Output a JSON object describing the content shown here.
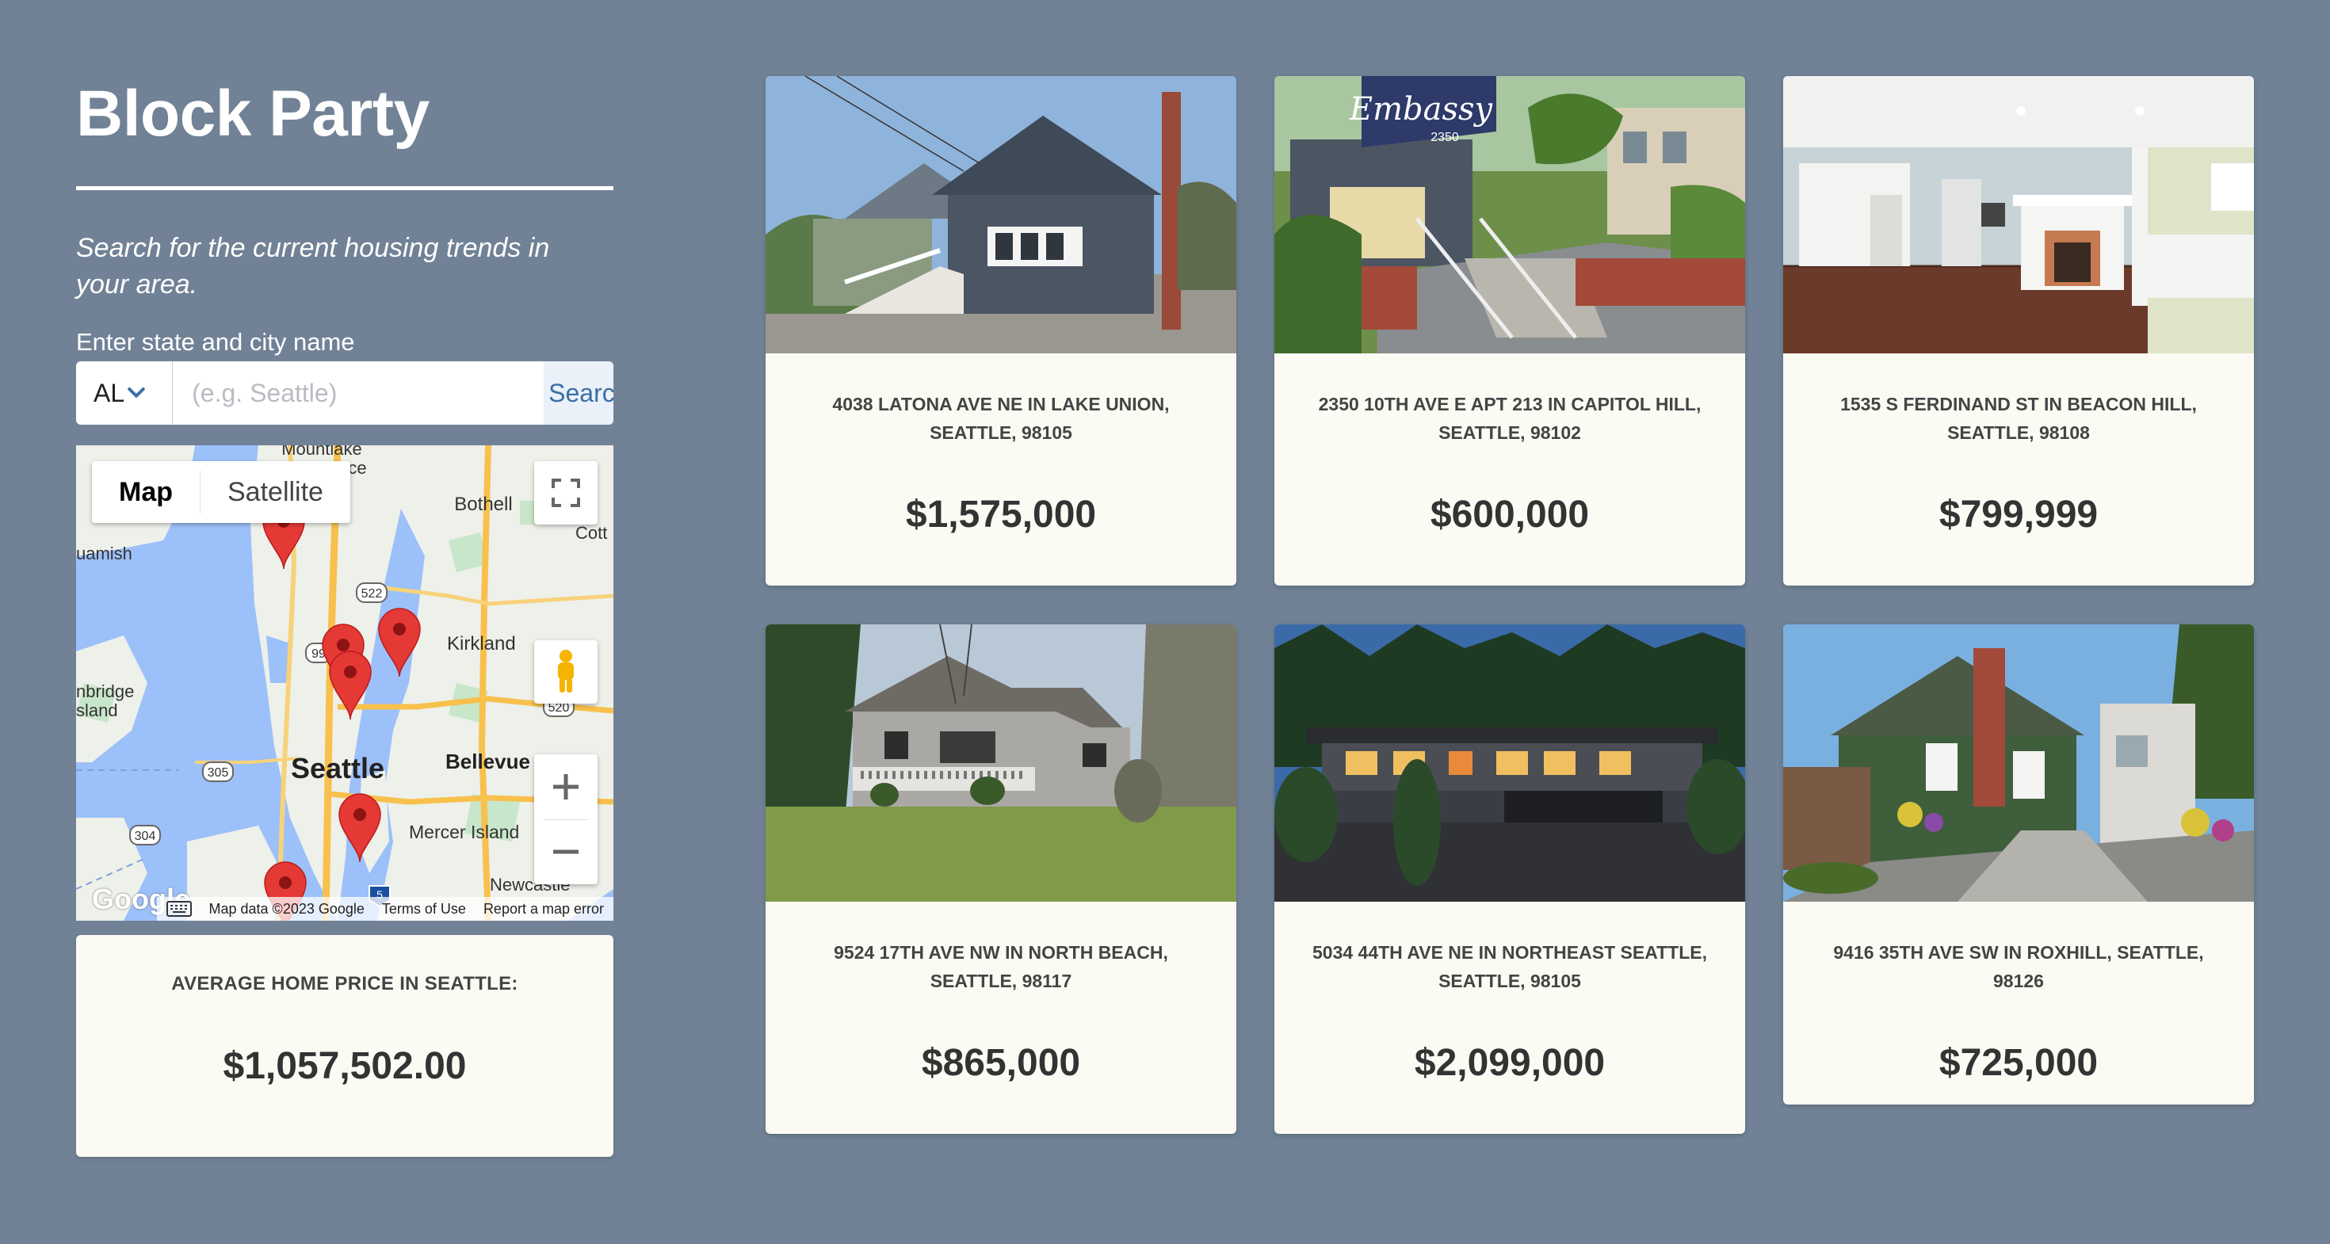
{
  "app": {
    "title": "Block Party",
    "tagline": "Search for the current housing trends in your area."
  },
  "search": {
    "label": "Enter state and city name",
    "state_value": "AL",
    "city_placeholder": "(e.g. Seattle)",
    "button_label": "Search"
  },
  "map": {
    "type_options": [
      "Map",
      "Satellite"
    ],
    "selected_type": "Map",
    "labels": {
      "mountlake": "Mountlake",
      "terrace": "Terrace",
      "bothell": "Bothell",
      "cott": "Cott",
      "uamish": "uamish",
      "kirkland": "Kirkland",
      "bridge": "nbridge",
      "island": "sland",
      "seattle": "Seattle",
      "bellevue": "Bellevue",
      "mercer": "Mercer Island",
      "newcastle": "Newcastle",
      "r522": "522",
      "r99": "99",
      "r520": "520",
      "r305": "305",
      "r304": "304",
      "r5": "5"
    },
    "logo": "Google",
    "attribution": "Map data ©2023 Google",
    "terms": "Terms of Use",
    "report": "Report a map error",
    "marker_count": 6
  },
  "average": {
    "label": "AVERAGE HOME PRICE IN SEATTLE:",
    "value": "$1,057,502.00"
  },
  "listings": [
    {
      "address": "4038 LATONA AVE NE IN LAKE UNION, SEATTLE, 98105",
      "price": "$1,575,000"
    },
    {
      "address": "2350 10TH AVE E APT 213 IN CAPITOL HILL, SEATTLE, 98102",
      "price": "$600,000",
      "sign": "Embassy",
      "sign_number": "2350"
    },
    {
      "address": "1535 S FERDINAND ST IN BEACON HILL, SEATTLE, 98108",
      "price": "$799,999"
    },
    {
      "address": "9524 17TH AVE NW IN NORTH BEACH, SEATTLE, 98117",
      "price": "$865,000"
    },
    {
      "address": "5034 44TH AVE NE IN NORTHEAST SEATTLE, SEATTLE, 98105",
      "price": "$2,099,000"
    },
    {
      "address": "9416 35TH AVE SW IN ROXHILL, SEATTLE, 98126",
      "price": "$725,000"
    }
  ],
  "colors": {
    "background": "#718296",
    "card": "#fbfbf4",
    "accent": "#3a6ea5",
    "marker": "#e53935"
  }
}
